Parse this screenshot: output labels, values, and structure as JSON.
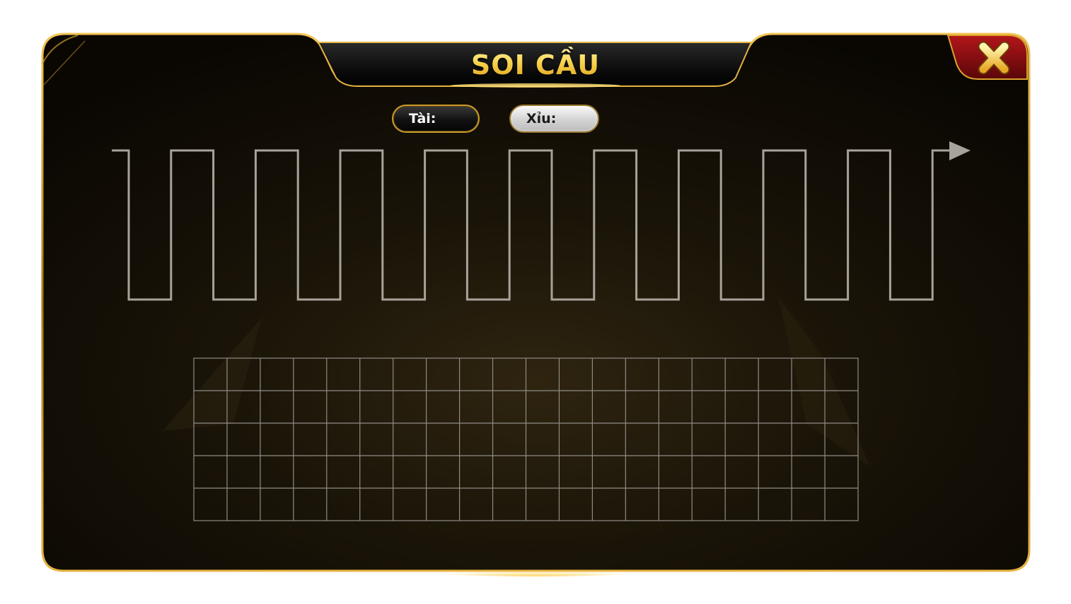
{
  "dialog": {
    "title": "SOI CẦU"
  },
  "legend": {
    "tai_label": "Tài:",
    "xiu_label": "Xỉu:"
  },
  "history_grid": {
    "columns": 20,
    "rows": 5
  },
  "colors": {
    "gold": "#d9a22a",
    "title_gold": "#f6c93c",
    "line": "#a8a39a",
    "close_red": "#8b0f12",
    "grid": "#8f8c86"
  },
  "icons": {
    "close": "close-x-icon",
    "trend_arrow": "arrow-right-icon"
  }
}
